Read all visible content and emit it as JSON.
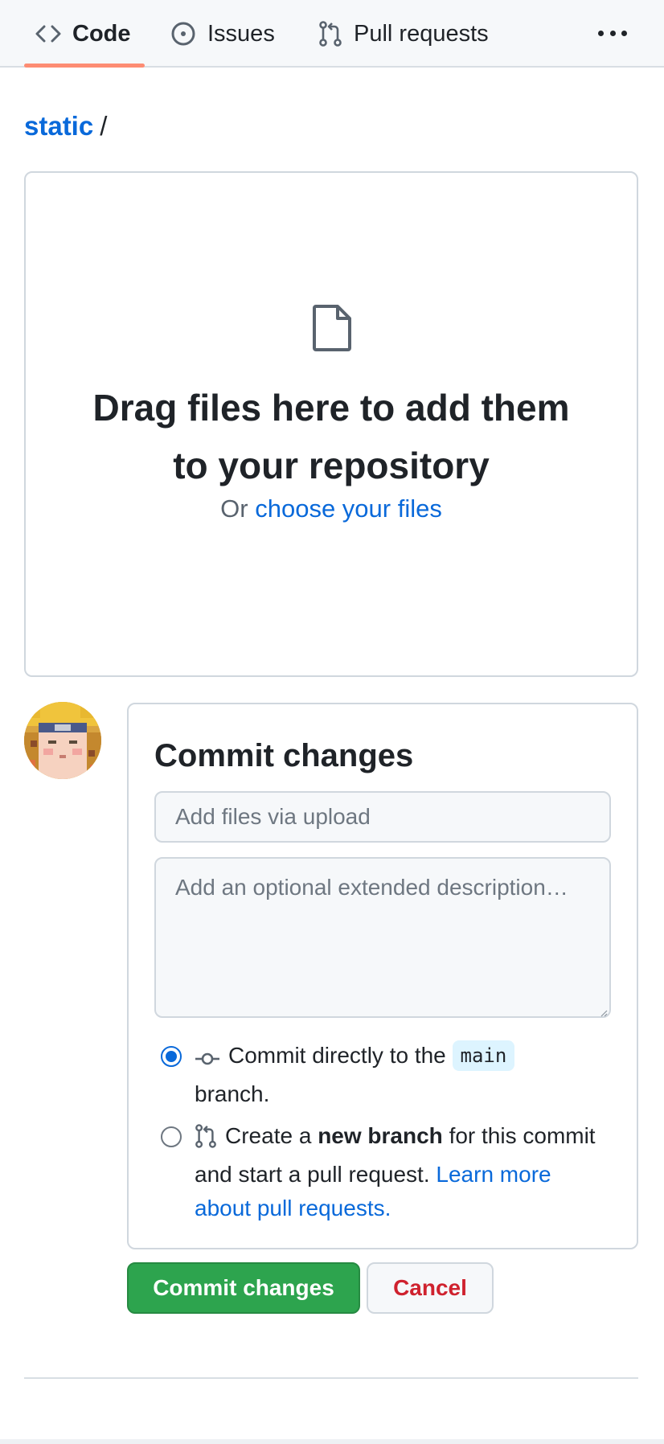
{
  "nav": {
    "tabs": [
      {
        "label": "Code",
        "icon": "code-icon",
        "selected": true
      },
      {
        "label": "Issues",
        "icon": "issue-opened-icon",
        "selected": false
      },
      {
        "label": "Pull requests",
        "icon": "git-pull-request-icon",
        "selected": false
      }
    ],
    "more_icon": "kebab-horizontal-icon",
    "accent_color": "#fd8c73"
  },
  "breadcrumb": {
    "folder": "static",
    "separator": "/"
  },
  "dropzone": {
    "icon": "file-icon",
    "title_line1": "Drag files here to add them",
    "title_line2": "to your repository",
    "or_text": "Or",
    "choose_link": "choose your files"
  },
  "commit": {
    "title": "Commit changes",
    "summary_placeholder": "Add files via upload",
    "summary_value": "",
    "description_placeholder": "Add an optional extended description…",
    "description_value": "",
    "option_direct": {
      "selected": true,
      "icon": "git-commit-icon",
      "text_before": "Commit directly to the",
      "branch": "main",
      "text_after": "branch."
    },
    "option_new_branch": {
      "selected": false,
      "icon": "git-pull-request-icon",
      "text_before": "Create a",
      "bold": "new branch",
      "text_after": "for this commit and start a pull request.",
      "link": "Learn more about pull requests."
    }
  },
  "buttons": {
    "commit_label": "Commit changes",
    "cancel_label": "Cancel",
    "commit_color": "#2da44e",
    "cancel_color": "#cf222e"
  }
}
